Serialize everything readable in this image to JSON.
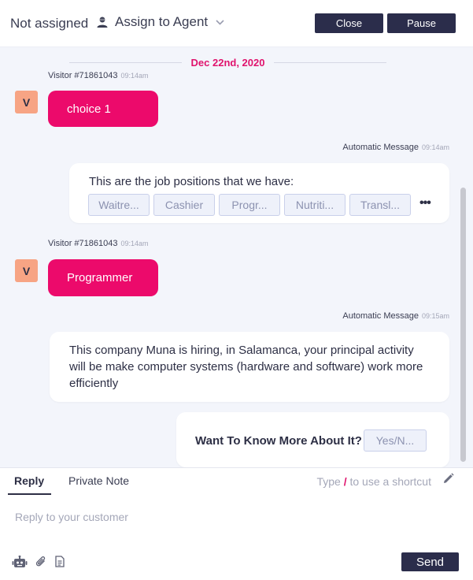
{
  "header": {
    "assignment_status": "Not assigned",
    "assign_to_agent_label": "Assign to Agent",
    "close_label": "Close",
    "pause_label": "Pause"
  },
  "conversation": {
    "date_separator": "Dec 22nd, 2020",
    "messages": [
      {
        "type": "visitor",
        "sender": "Visitor #71861043",
        "time": "09:14am",
        "avatar": "V",
        "text": "choice 1"
      },
      {
        "type": "automatic",
        "sender": "Automatic Message",
        "time": "09:14am",
        "text": "This are the job positions that we have:",
        "options": [
          "Waitre...",
          "Cashier",
          "Progr...",
          "Nutriti...",
          "Transl..."
        ],
        "more": "•••"
      },
      {
        "type": "visitor",
        "sender": "Visitor #71861043",
        "time": "09:14am",
        "avatar": "V",
        "text": "Programmer"
      },
      {
        "type": "automatic",
        "sender": "Automatic Message",
        "time": "09:15am",
        "text": "This company Muna is hiring, in Salamanca, your principal activity will be make computer systems (hardware and software) work more efficiently"
      },
      {
        "type": "automatic-question",
        "question": "Want To Know More About It?",
        "option": "Yes/N..."
      }
    ]
  },
  "composer": {
    "tabs": [
      "Reply",
      "Private Note"
    ],
    "shortcut_prefix": "Type",
    "shortcut_key": "/",
    "shortcut_suffix": "to use a shortcut",
    "placeholder": "Reply to your customer",
    "send_label": "Send",
    "icons": [
      "bot-icon",
      "attachment-icon",
      "document-icon",
      "pencil-icon"
    ]
  },
  "colors": {
    "accent": "#ec0a6b",
    "dark_button": "#2b2d4b",
    "avatar_bg": "#f7a484",
    "chat_bg": "#f3f5fb"
  }
}
